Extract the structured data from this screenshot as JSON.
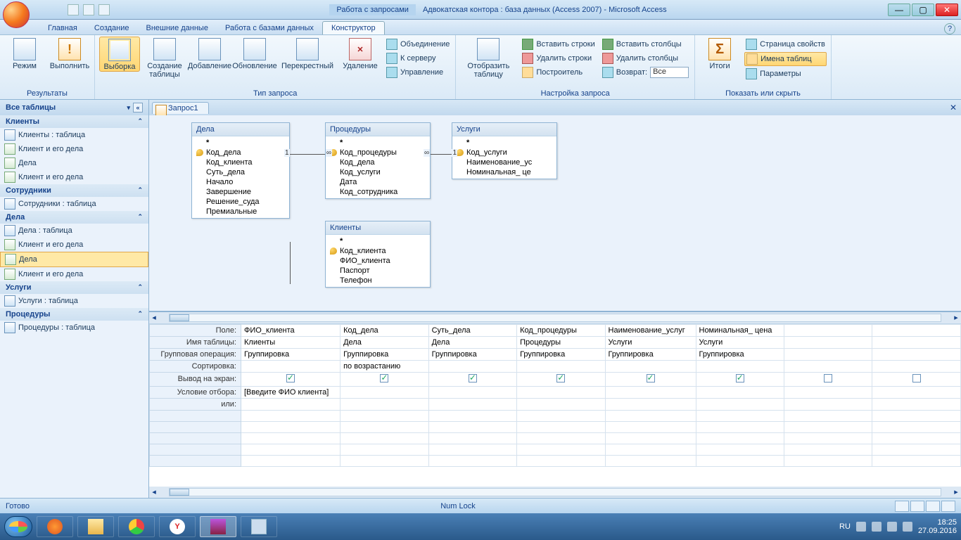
{
  "titlebar": {
    "contextual_title": "Работа с запросами",
    "main_title": "Адвокатская контора : база данных (Access 2007) - Microsoft Access"
  },
  "tabs": {
    "home": "Главная",
    "create": "Создание",
    "external": "Внешние данные",
    "dbtools": "Работа с базами данных",
    "design": "Конструктор"
  },
  "ribbon": {
    "results": {
      "view": "Режим",
      "run": "Выполнить",
      "group": "Результаты"
    },
    "querytype": {
      "select": "Выборка",
      "maketable": "Создание\nтаблицы",
      "append": "Добавление",
      "update": "Обновление",
      "crosstab": "Перекрестный",
      "delete": "Удаление",
      "union": "Объединение",
      "passthrough": "К серверу",
      "ddl": "Управление",
      "group": "Тип запроса"
    },
    "setup": {
      "showtable": "Отобразить\nтаблицу",
      "insertrows": "Вставить строки",
      "deleterows": "Удалить строки",
      "builder": "Построитель",
      "insertcols": "Вставить столбцы",
      "deletecols": "Удалить столбцы",
      "return": "Возврат:",
      "return_val": "Все",
      "group": "Настройка запроса"
    },
    "showhide": {
      "totals": "Итоги",
      "propsheet": "Страница свойств",
      "tablenames": "Имена таблиц",
      "params": "Параметры",
      "group": "Показать или скрыть"
    }
  },
  "navpane": {
    "header": "Все таблицы",
    "groups": [
      {
        "title": "Клиенты",
        "items": [
          {
            "icon": "tbl",
            "label": "Клиенты : таблица"
          },
          {
            "icon": "qry",
            "label": "Клиент и его дела"
          },
          {
            "icon": "qry",
            "label": "Дела"
          },
          {
            "icon": "qry",
            "label": "Клиент и его дела"
          }
        ]
      },
      {
        "title": "Сотрудники",
        "items": [
          {
            "icon": "tbl",
            "label": "Сотрудники : таблица"
          }
        ]
      },
      {
        "title": "Дела",
        "items": [
          {
            "icon": "tbl",
            "label": "Дела : таблица"
          },
          {
            "icon": "qry",
            "label": "Клиент и его дела"
          },
          {
            "icon": "qry",
            "label": "Дела",
            "selected": true
          },
          {
            "icon": "qry",
            "label": "Клиент и его дела"
          }
        ]
      },
      {
        "title": "Услуги",
        "items": [
          {
            "icon": "tbl",
            "label": "Услуги : таблица"
          }
        ]
      },
      {
        "title": "Процедуры",
        "items": [
          {
            "icon": "tbl",
            "label": "Процедуры : таблица"
          }
        ]
      }
    ]
  },
  "doctab": "Запрос1",
  "tables": {
    "dela": {
      "title": "Дела",
      "fields": [
        "*",
        "Код_дела",
        "Код_клиента",
        "Суть_дела",
        "Начало",
        "Завершение",
        "Решение_суда",
        "Премиальные"
      ],
      "key": 1
    },
    "proc": {
      "title": "Процедуры",
      "fields": [
        "*",
        "Код_процедуры",
        "Код_дела",
        "Код_услуги",
        "Дата",
        "Код_сотрудника"
      ],
      "key": 1
    },
    "uslugi": {
      "title": "Услуги",
      "fields": [
        "*",
        "Код_услуги",
        "Наименование_ус",
        "Номинальная_ це"
      ],
      "key": 1
    },
    "klienty": {
      "title": "Клиенты",
      "fields": [
        "*",
        "Код_клиента",
        "ФИО_клиента",
        "Паспорт",
        "Телефон"
      ],
      "key": 1
    }
  },
  "qbe": {
    "rows": {
      "field": "Поле:",
      "table": "Имя таблицы:",
      "total": "Групповая операция:",
      "sort": "Сортировка:",
      "show": "Вывод на экран:",
      "criteria": "Условие отбора:",
      "or": "или:"
    },
    "cols": [
      {
        "field": "ФИО_клиента",
        "table": "Клиенты",
        "total": "Группировка",
        "sort": "",
        "show": true,
        "criteria": "[Введите ФИО клиента]"
      },
      {
        "field": "Код_дела",
        "table": "Дела",
        "total": "Группировка",
        "sort": "по возрастанию",
        "show": true,
        "criteria": ""
      },
      {
        "field": "Суть_дела",
        "table": "Дела",
        "total": "Группировка",
        "sort": "",
        "show": true,
        "criteria": ""
      },
      {
        "field": "Код_процедуры",
        "table": "Процедуры",
        "total": "Группировка",
        "sort": "",
        "show": true,
        "criteria": ""
      },
      {
        "field": "Наименование_услуг",
        "table": "Услуги",
        "total": "Группировка",
        "sort": "",
        "show": true,
        "criteria": ""
      },
      {
        "field": "Номинальная_ цена",
        "table": "Услуги",
        "total": "Группировка",
        "sort": "",
        "show": true,
        "criteria": ""
      },
      {
        "field": "",
        "table": "",
        "total": "",
        "sort": "",
        "show": false,
        "criteria": ""
      },
      {
        "field": "",
        "table": "",
        "total": "",
        "sort": "",
        "show": false,
        "criteria": ""
      }
    ]
  },
  "status": {
    "ready": "Готово",
    "numlock": "Num Lock"
  },
  "systray": {
    "lang": "RU",
    "time": "18:25",
    "date": "27.09.2016"
  }
}
